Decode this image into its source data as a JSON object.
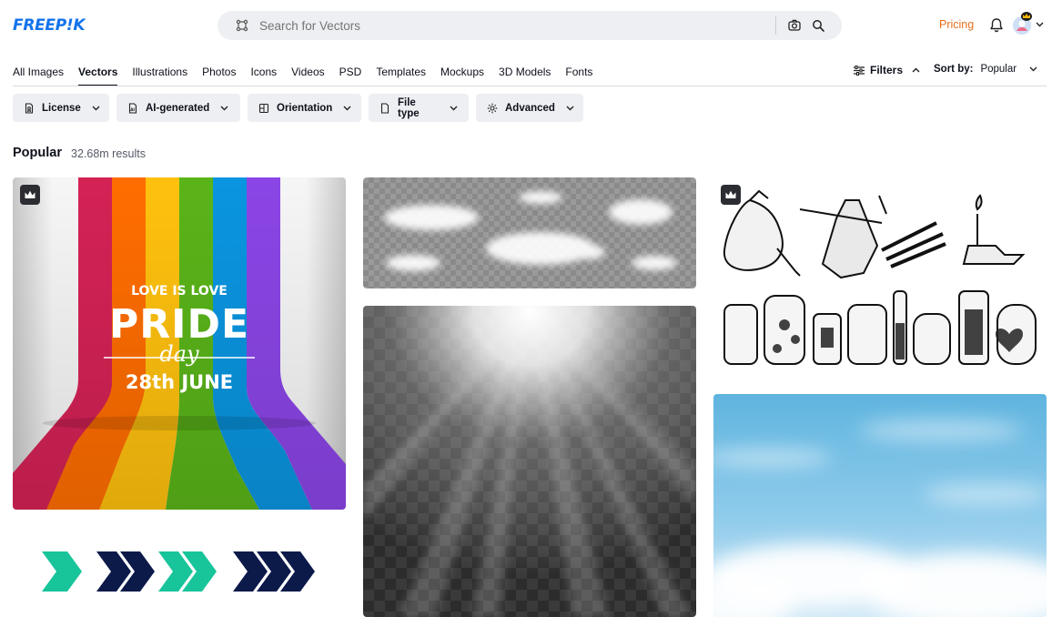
{
  "header": {
    "logo_text": "FREEP!K",
    "search_placeholder": "Search for Vectors",
    "pricing_label": "Pricing"
  },
  "tabs": [
    {
      "label": "All Images",
      "active": false
    },
    {
      "label": "Vectors",
      "active": true
    },
    {
      "label": "Illustrations",
      "active": false
    },
    {
      "label": "Photos",
      "active": false
    },
    {
      "label": "Icons",
      "active": false
    },
    {
      "label": "Videos",
      "active": false
    },
    {
      "label": "PSD",
      "active": false
    },
    {
      "label": "Templates",
      "active": false
    },
    {
      "label": "Mockups",
      "active": false
    },
    {
      "label": "3D Models",
      "active": false
    },
    {
      "label": "Fonts",
      "active": false
    }
  ],
  "toolbar": {
    "filters_label": "Filters",
    "sort_label": "Sort by:",
    "sort_value": "Popular"
  },
  "filter_pills": [
    {
      "label": "License",
      "icon": "license-icon"
    },
    {
      "label": "AI-generated",
      "icon": "ai-icon"
    },
    {
      "label": "Orientation",
      "icon": "orientation-icon"
    },
    {
      "label": "File type",
      "icon": "file-icon"
    },
    {
      "label": "Advanced",
      "icon": "gear-icon"
    }
  ],
  "results": {
    "title": "Popular",
    "count": "32.68m results"
  },
  "cards": {
    "pride": {
      "line1": "LOVE IS LOVE",
      "line2": "PRIDE",
      "line3": "day",
      "line4": "28th JUNE",
      "premium": true
    },
    "clouds": {
      "premium": false
    },
    "rays": {
      "premium": false
    },
    "sketch": {
      "premium": true
    },
    "sky": {
      "premium": false
    },
    "arrows": {
      "premium": false
    }
  },
  "colors": {
    "brand": "#1273eb",
    "pricing": "#e5701f",
    "pill_bg": "#eeeff2"
  }
}
